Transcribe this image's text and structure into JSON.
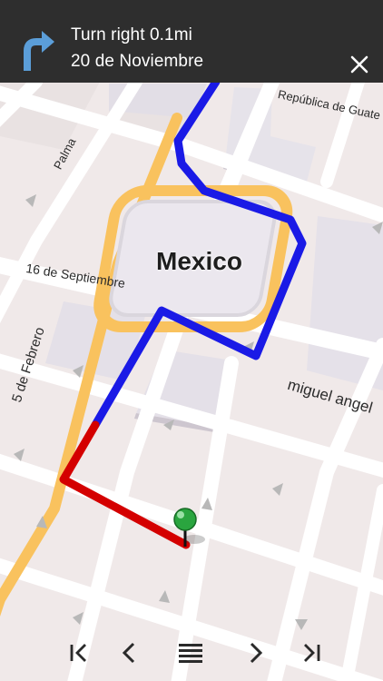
{
  "banner": {
    "instruction": "Turn right 0.1mi",
    "street": "20 de Noviembre",
    "turn_icon": "turn-right-arrow-icon",
    "close_icon": "close-icon"
  },
  "map": {
    "place_label": "Mexico",
    "street_labels": {
      "republica": "República de Guate",
      "palma": "Palma",
      "septiembre": "16 de Septiembre",
      "febrero": "5 de Febrero",
      "miguel": "miguel angel"
    },
    "route_colors": {
      "upcoming": "#1a1ae6",
      "traveled": "#d40000",
      "highlight_road": "#f9c25e"
    }
  },
  "controls": [
    {
      "name": "first-step-button",
      "icon": "skip-first-icon"
    },
    {
      "name": "previous-step-button",
      "icon": "chevron-left-icon"
    },
    {
      "name": "directions-list-button",
      "icon": "list-icon"
    },
    {
      "name": "next-step-button",
      "icon": "chevron-right-icon"
    },
    {
      "name": "last-step-button",
      "icon": "skip-last-icon"
    }
  ]
}
